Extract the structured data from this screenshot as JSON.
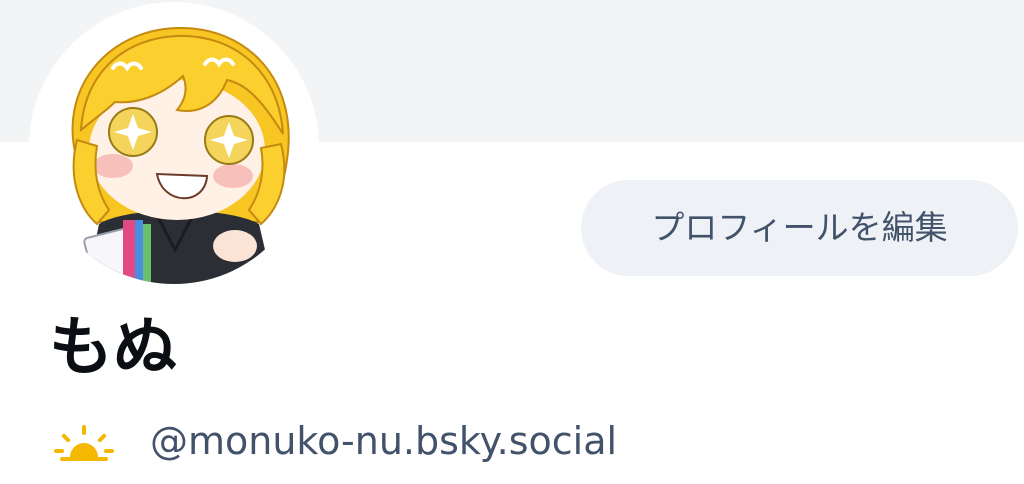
{
  "profile": {
    "display_name": "もぬ",
    "handle": "@monuko-nu.bsky.social",
    "handle_icon": "sun-icon",
    "avatar_icon": "anime-avatar-image"
  },
  "actions": {
    "edit_profile_label": "プロフィールを編集"
  },
  "colors": {
    "banner": "#f3f4f6",
    "button_bg": "#eef1f5",
    "button_text": "#42526a",
    "handle_text": "#42526a",
    "name_text": "#0b0f14",
    "sun_icon": "#f5b800"
  }
}
